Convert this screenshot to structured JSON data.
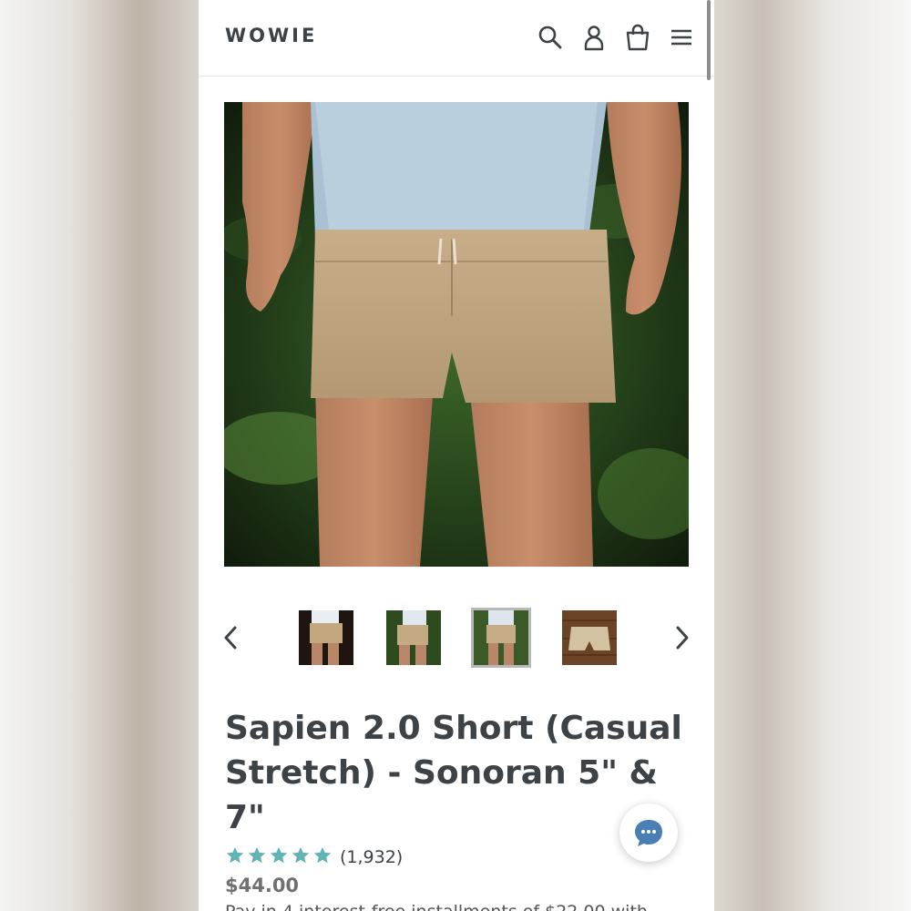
{
  "header": {
    "logo": "WOWIE",
    "icons": [
      "search-icon",
      "account-icon",
      "cart-icon",
      "menu-icon"
    ]
  },
  "product": {
    "title": "Sapien 2.0 Short (Casual Stretch) - Sonoran 5\" & 7\"",
    "rating_stars": 5,
    "review_count": "(1,932)",
    "price": "$44.00",
    "truncated_line": "Pay in 4 interest-free installments of $22.00 with"
  },
  "gallery": {
    "thumbnail_count": 4,
    "active_thumbnail": 3
  },
  "colors": {
    "star": "#5fb3b3",
    "text": "#3d4246",
    "price": "#707070"
  }
}
